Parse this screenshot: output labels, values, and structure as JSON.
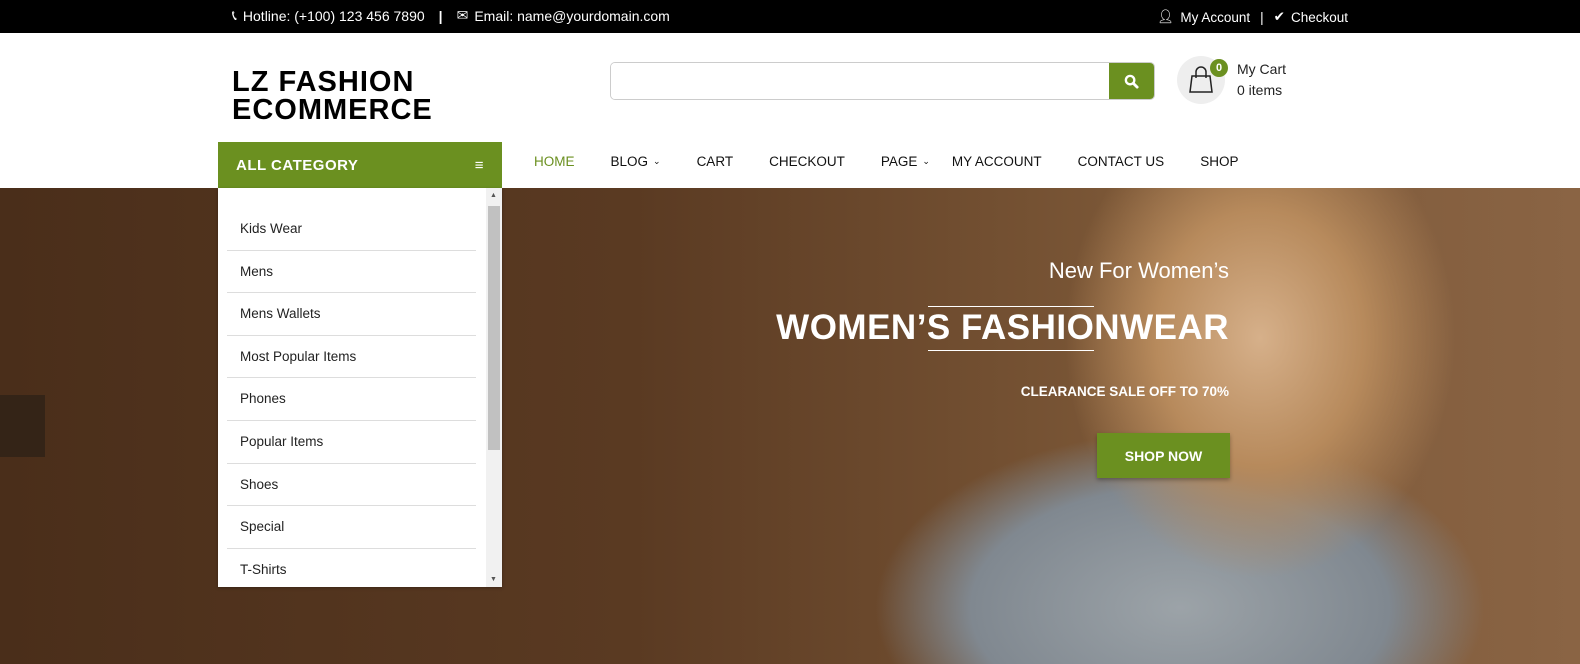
{
  "topbar": {
    "hotline": "Hotline: (+100) 123 456 7890",
    "sep": "|",
    "email": "Email: name@yourdomain.com",
    "my_account": "My Account",
    "checkout": "Checkout"
  },
  "logo": {
    "line1": "LZ FASHION",
    "line2": "ECOMMERCE"
  },
  "search": {
    "value": "",
    "placeholder": ""
  },
  "cart": {
    "count": "0",
    "title": "My Cart",
    "items": "0 items"
  },
  "category": {
    "title": "ALL CATEGORY",
    "items": [
      "Kids Wear",
      "Mens",
      "Mens Wallets",
      "Most Popular Items",
      "Phones",
      "Popular Items",
      "Shoes",
      "Special",
      "T-Shirts"
    ]
  },
  "nav": {
    "items": [
      {
        "label": "HOME"
      },
      {
        "label": "BLOG"
      },
      {
        "label": "CART"
      },
      {
        "label": "CHECKOUT"
      },
      {
        "label": "PAGE"
      },
      {
        "label": "MY ACCOUNT"
      },
      {
        "label": "CONTACT US"
      },
      {
        "label": "SHOP"
      }
    ]
  },
  "hero": {
    "subtitle": "New For Women’s",
    "title": "WOMEN’S FASHIONWEAR",
    "sale": "CLEARANCE SALE OFF TO 70%",
    "cta": "SHOP NOW"
  },
  "colors": {
    "accent": "#6b9020",
    "topbar": "#000000"
  }
}
